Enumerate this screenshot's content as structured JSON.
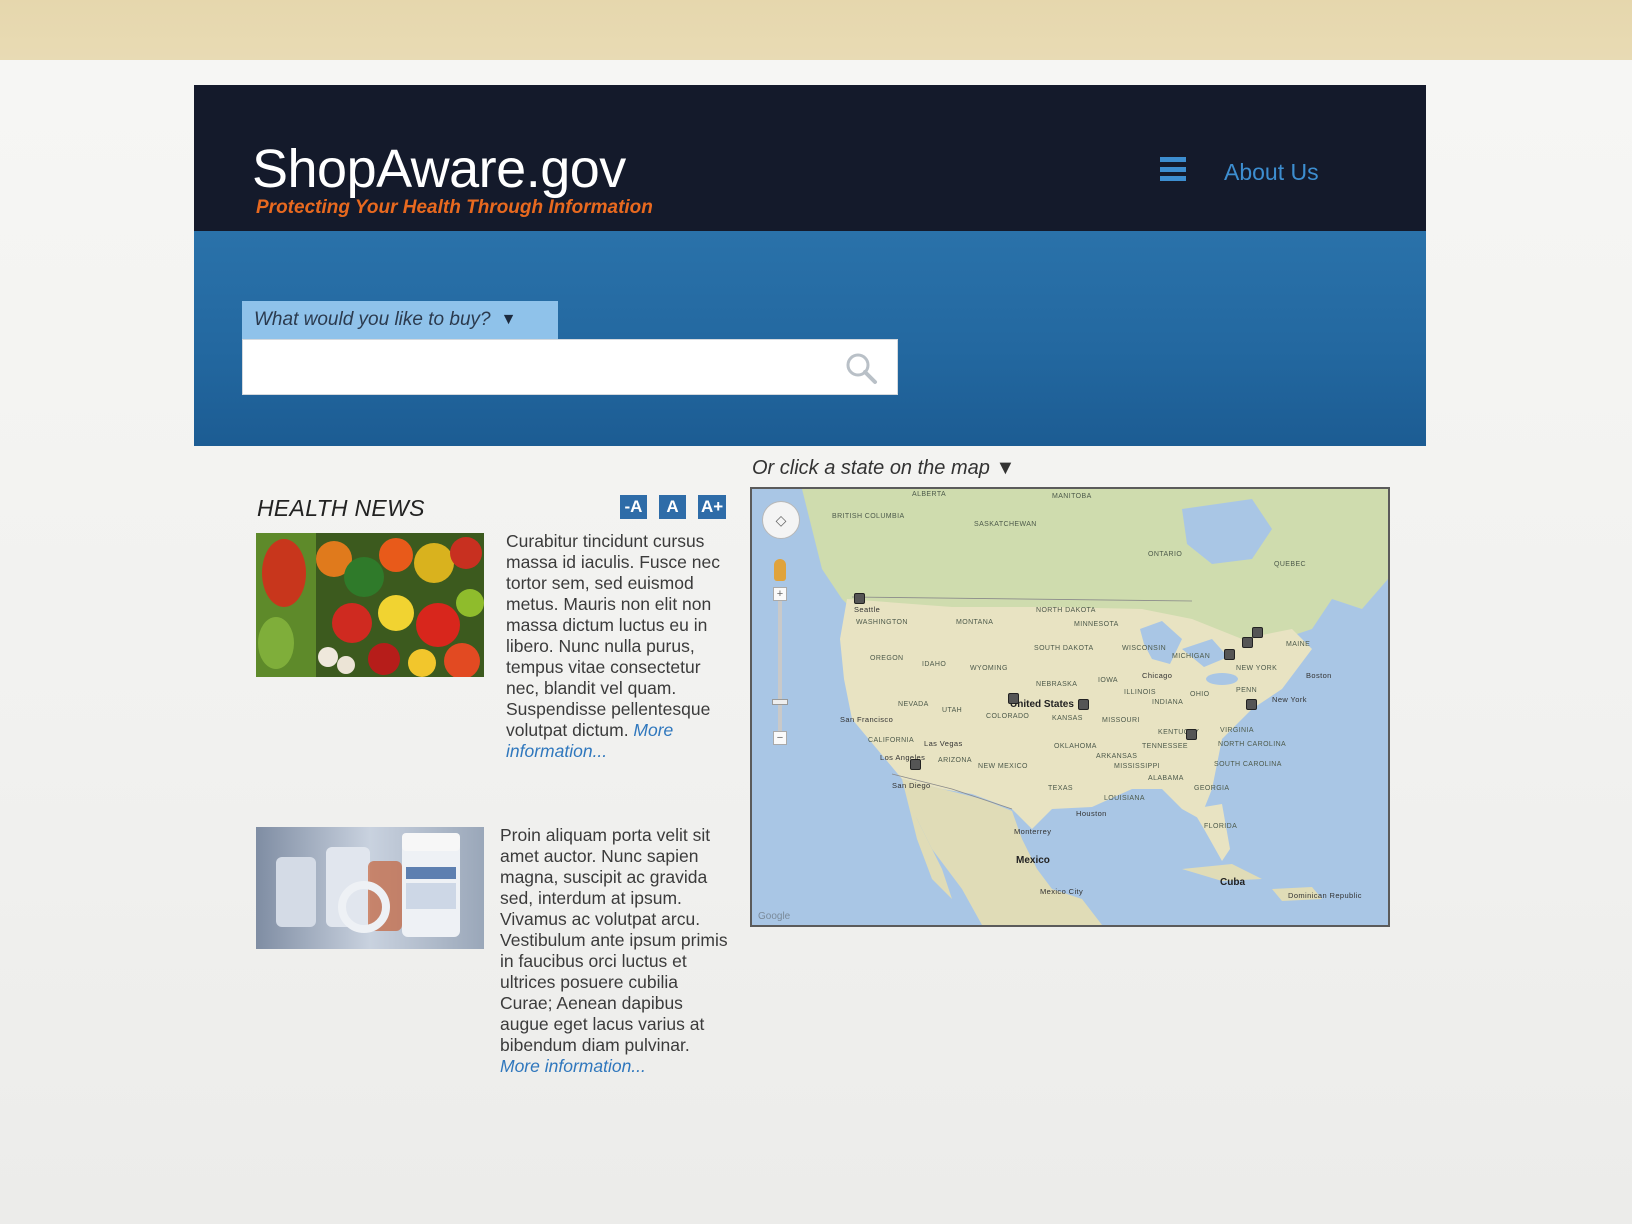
{
  "site": {
    "title": "ShopAware.gov",
    "tagline": "Protecting Your Health Through Information"
  },
  "nav": {
    "menu_icon": "hamburger-menu-icon",
    "about_label": "About Us"
  },
  "search": {
    "category_label": "What would you like to buy?",
    "category_caret": "▼",
    "value": "",
    "placeholder": "",
    "icon": "search-icon"
  },
  "news": {
    "heading": "HEALTH NEWS",
    "font_size_buttons": [
      "-A",
      "A",
      "A+"
    ],
    "articles": [
      {
        "image": "vegetables-photo",
        "text": "Curabitur tincidunt cursus massa id iaculis. Fusce nec tortor sem, sed euismod metus. Mauris non elit non massa dictum luctus eu in libero. Nunc nulla purus, tempus vitae consectetur nec, blandit vel quam. Suspendisse pellentesque volutpat dictum. ",
        "more_label": "More information..."
      },
      {
        "image": "pill-bottles-photo",
        "text": "Proin aliquam porta velit sit amet auctor. Nunc sapien magna, suscipit ac gravida sed, interdum at ipsum. Vivamus ac volutpat arcu. Vestibulum ante ipsum primis in faucibus orci luctus et ultrices posuere cubilia Curae; Aenean dapibus augue eget lacus varius at bibendum diam pulvinar. ",
        "more_label": "More information..."
      }
    ]
  },
  "map": {
    "prompt": "Or click a state on the map",
    "prompt_caret": "▼",
    "country_labels": [
      "United States",
      "Mexico",
      "Cuba"
    ],
    "region_labels": [
      "British Columbia",
      "Alberta",
      "Saskatchewan",
      "Manitoba",
      "Ontario",
      "Quebec",
      "Washington",
      "Oregon",
      "Idaho",
      "Montana",
      "Wyoming",
      "Nevada",
      "Utah",
      "Colorado",
      "California",
      "Arizona",
      "New Mexico",
      "Texas",
      "Oklahoma",
      "Kansas",
      "Nebraska",
      "South Dakota",
      "North Dakota",
      "Minnesota",
      "Iowa",
      "Missouri",
      "Arkansas",
      "Louisiana",
      "Mississippi",
      "Alabama",
      "Georgia",
      "Florida",
      "Tennessee",
      "Kentucky",
      "Illinois",
      "Indiana",
      "Ohio",
      "Michigan",
      "Wisconsin",
      "Penn",
      "New York",
      "Virginia",
      "North Carolina",
      "South Carolina",
      "Maine"
    ],
    "city_labels": [
      "Seattle",
      "San Francisco",
      "Las Vegas",
      "Los Angeles",
      "San Diego",
      "Chicago",
      "Boston",
      "New York",
      "Houston",
      "Monterrey",
      "Mexico City",
      "Dominican Republic"
    ],
    "attribution": "Google",
    "controls": {
      "pan_icon": "pan-control-icon",
      "pegman_icon": "street-view-pegman-icon",
      "zoom_in": "+",
      "zoom_out": "−"
    },
    "colors": {
      "water": "#a9c6e5",
      "land": "#e8e3c2",
      "forest": "#cfdcae"
    }
  },
  "colors": {
    "header_bg": "#141a2b",
    "hero_bg": "#2368a0",
    "accent": "#3d8ed0",
    "tagline": "#e8691f",
    "button_bg": "#2e6ca8"
  }
}
